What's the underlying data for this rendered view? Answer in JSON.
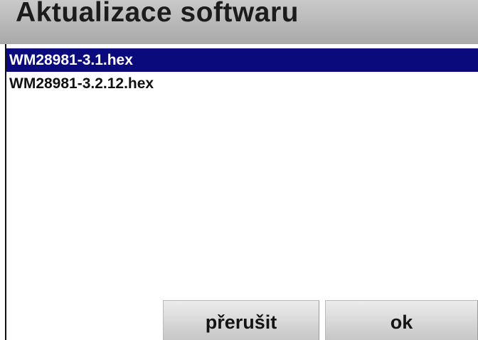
{
  "header": {
    "title": "Aktualizace softwaru"
  },
  "file_list": {
    "items": [
      {
        "label": "WM28981-3.1.hex",
        "selected": true
      },
      {
        "label": "WM28981-3.2.12.hex",
        "selected": false
      }
    ]
  },
  "actions": {
    "cancel_label": "přerušit",
    "ok_label": "ok"
  },
  "colors": {
    "selection": "#0a0a7d",
    "title_bar": "#b5b5b5"
  }
}
